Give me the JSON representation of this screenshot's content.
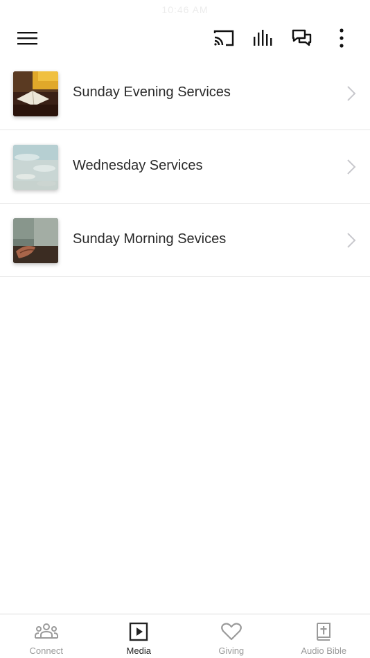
{
  "status_bar": {
    "time": "10:46 AM"
  },
  "toolbar": {
    "icons": [
      "menu-icon",
      "cast-icon",
      "audio-bars-icon",
      "chat-icon",
      "more-vertical-icon"
    ]
  },
  "media_list": {
    "items": [
      {
        "label": "Sunday Evening Services",
        "thumbnail": "bible-reading-photo"
      },
      {
        "label": "Wednesday Services",
        "thumbnail": "water-surface-photo"
      },
      {
        "label": "Sunday Morning Sevices",
        "thumbnail": "praying-hands-photo"
      }
    ]
  },
  "tab_bar": {
    "active": "Media",
    "tabs": [
      {
        "label": "Connect",
        "icon": "people-icon"
      },
      {
        "label": "Media",
        "icon": "play-icon"
      },
      {
        "label": "Giving",
        "icon": "heart-icon"
      },
      {
        "label": "Audio Bible",
        "icon": "bible-cross-icon"
      }
    ]
  },
  "colors": {
    "text": "#2a2a2a",
    "inactive_tab": "#9a9a9a",
    "divider": "#e6e6e6",
    "chevron": "#c7c7cc"
  }
}
